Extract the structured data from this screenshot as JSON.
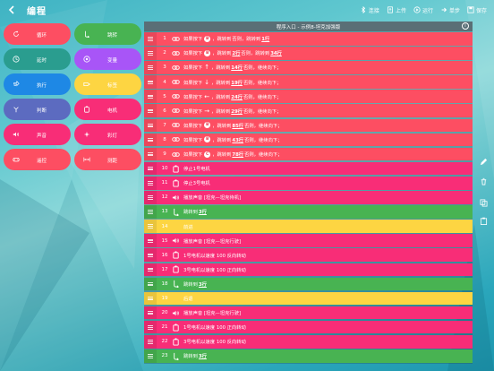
{
  "topbar": {
    "title": "编程",
    "tools": [
      {
        "icon": "bluetooth-icon",
        "label": "连接"
      },
      {
        "icon": "upload-icon",
        "label": "上传"
      },
      {
        "icon": "run-icon",
        "label": "运行"
      },
      {
        "icon": "step-icon",
        "label": "单步"
      },
      {
        "icon": "save-icon",
        "label": "保存"
      }
    ]
  },
  "palette": [
    {
      "label": "循环",
      "icon": "loop-icon",
      "color": "#fd4e62"
    },
    {
      "label": "跳转",
      "icon": "jump-icon",
      "color": "#48b352"
    },
    {
      "label": "延时",
      "icon": "clock-icon",
      "color": "#2a9d8f"
    },
    {
      "label": "变量",
      "icon": "variable-icon",
      "color": "#a855f7"
    },
    {
      "label": "执行",
      "icon": "execute-icon",
      "color": "#1e88e5"
    },
    {
      "label": "标签",
      "icon": "label-icon",
      "color": "#fdd542"
    },
    {
      "label": "判断",
      "icon": "branch-icon",
      "color": "#5c6bc0"
    },
    {
      "label": "电机",
      "icon": "motor-icon",
      "color": "#f82d77"
    },
    {
      "label": "声音",
      "icon": "speaker-icon",
      "color": "#f82d77"
    },
    {
      "label": "彩灯",
      "icon": "light-icon",
      "color": "#f82d77"
    },
    {
      "label": "遥控",
      "icon": "gamepad-icon",
      "color": "#fd4e62"
    },
    {
      "label": "测距",
      "icon": "distance-icon",
      "color": "#fd4e62"
    }
  ],
  "program": {
    "title": "程序入口 - 示例8-坦克加强版",
    "rows": [
      {
        "n": "1",
        "color": "red",
        "icon": "link-icon",
        "pre": "如果按下",
        "key": "B",
        "arrow": "",
        "mid": "，跳转到",
        "target": "",
        "post": "否则，跳转到",
        "target2": "1行"
      },
      {
        "n": "2",
        "color": "red",
        "icon": "link-icon",
        "pre": "如果按下",
        "key": "B",
        "arrow": "",
        "mid": "，跳转到",
        "target": "2行",
        "post": "否则，跳转到",
        "target2": "34行"
      },
      {
        "n": "3",
        "color": "red",
        "icon": "link-icon",
        "pre": "如果按下",
        "key": "",
        "arrow": "↑",
        "mid": "，跳转到",
        "target": "14行",
        "post": "否则，继续向下；",
        "target2": ""
      },
      {
        "n": "4",
        "color": "red",
        "icon": "link-icon",
        "pre": "如果按下",
        "key": "",
        "arrow": "↓",
        "mid": "，跳转到",
        "target": "19行",
        "post": "否则，继续向下；",
        "target2": ""
      },
      {
        "n": "5",
        "color": "red",
        "icon": "link-icon",
        "pre": "如果按下",
        "key": "",
        "arrow": "←",
        "mid": "，跳转到",
        "target": "24行",
        "post": "否则，继续向下；",
        "target2": ""
      },
      {
        "n": "6",
        "color": "red",
        "icon": "link-icon",
        "pre": "如果按下",
        "key": "",
        "arrow": "→",
        "mid": "，跳转到",
        "target": "29行",
        "post": "否则，继续向下；",
        "target2": ""
      },
      {
        "n": "7",
        "color": "red",
        "icon": "link-icon",
        "pre": "如果按下",
        "key": "B",
        "arrow": "",
        "mid": "，跳转到",
        "target": "85行",
        "post": "否则，继续向下；",
        "target2": ""
      },
      {
        "n": "8",
        "color": "red",
        "icon": "link-icon",
        "pre": "如果按下",
        "key": "B",
        "arrow": "",
        "mid": "，跳转到",
        "target": "43行",
        "post": "否则，继续向下；",
        "target2": ""
      },
      {
        "n": "9",
        "color": "red",
        "icon": "link-icon",
        "pre": "如果按下",
        "key": "C",
        "arrow": "",
        "mid": "，跳转到",
        "target": "78行",
        "post": "否则，继续向下；",
        "target2": ""
      },
      {
        "n": "10",
        "color": "pink",
        "icon": "motor-icon",
        "pre": "停止1号电机",
        "key": "",
        "arrow": "",
        "mid": "",
        "target": "",
        "post": "",
        "target2": ""
      },
      {
        "n": "11",
        "color": "pink",
        "icon": "motor-icon",
        "pre": "停止3号电机",
        "key": "",
        "arrow": "",
        "mid": "",
        "target": "",
        "post": "",
        "target2": ""
      },
      {
        "n": "12",
        "color": "pink",
        "icon": "speaker-icon",
        "pre": "播放声音 [坦克—坦克待机]",
        "key": "",
        "arrow": "",
        "mid": "",
        "target": "",
        "post": "",
        "target2": ""
      },
      {
        "n": "13",
        "color": "green",
        "icon": "jump-icon",
        "pre": "跳转到",
        "key": "",
        "arrow": "",
        "mid": "",
        "target": "3行",
        "post": "",
        "target2": ""
      },
      {
        "n": "14",
        "color": "yellow",
        "icon": "",
        "pre": "前进",
        "key": "",
        "arrow": "",
        "mid": "",
        "target": "",
        "post": "",
        "target2": ""
      },
      {
        "n": "15",
        "color": "pink",
        "icon": "speaker-icon",
        "pre": "播放声音 [坦克—坦克行驶]",
        "key": "",
        "arrow": "",
        "mid": "",
        "target": "",
        "post": "",
        "target2": ""
      },
      {
        "n": "16",
        "color": "pink",
        "icon": "motor-icon",
        "pre": "1号电机以速度 100 反向转动",
        "key": "",
        "arrow": "",
        "mid": "",
        "target": "",
        "post": "",
        "target2": ""
      },
      {
        "n": "17",
        "color": "pink",
        "icon": "motor-icon",
        "pre": "3号电机以速度 100 正向转动",
        "key": "",
        "arrow": "",
        "mid": "",
        "target": "",
        "post": "",
        "target2": ""
      },
      {
        "n": "18",
        "color": "green",
        "icon": "jump-icon",
        "pre": "跳转到",
        "key": "",
        "arrow": "",
        "mid": "",
        "target": "3行",
        "post": "",
        "target2": ""
      },
      {
        "n": "19",
        "color": "yellow",
        "icon": "",
        "pre": "后退",
        "key": "",
        "arrow": "",
        "mid": "",
        "target": "",
        "post": "",
        "target2": ""
      },
      {
        "n": "20",
        "color": "pink",
        "icon": "speaker-icon",
        "pre": "播放声音 [坦克—坦克行驶]",
        "key": "",
        "arrow": "",
        "mid": "",
        "target": "",
        "post": "",
        "target2": ""
      },
      {
        "n": "21",
        "color": "pink",
        "icon": "motor-icon",
        "pre": "1号电机以速度 100 正向转动",
        "key": "",
        "arrow": "",
        "mid": "",
        "target": "",
        "post": "",
        "target2": ""
      },
      {
        "n": "22",
        "color": "pink",
        "icon": "motor-icon",
        "pre": "3号电机以速度 100 反向转动",
        "key": "",
        "arrow": "",
        "mid": "",
        "target": "",
        "post": "",
        "target2": ""
      },
      {
        "n": "23",
        "color": "green",
        "icon": "jump-icon",
        "pre": "跳转到",
        "key": "",
        "arrow": "",
        "mid": "",
        "target": "3行",
        "post": "",
        "target2": ""
      }
    ]
  },
  "side_tools": [
    {
      "icon": "pencil-icon"
    },
    {
      "icon": "trash-icon"
    },
    {
      "icon": "copy-icon"
    },
    {
      "icon": "paste-icon"
    }
  ]
}
